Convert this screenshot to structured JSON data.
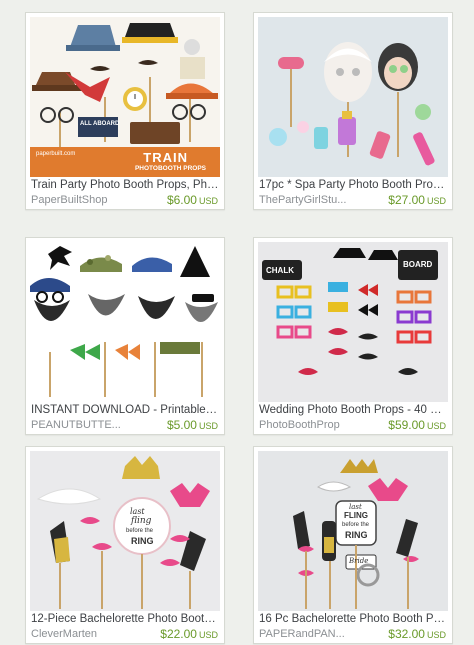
{
  "listings": [
    {
      "title": "Train Party Photo Booth Props, Phot...",
      "shop": "PaperBuiltShop",
      "price": "$6.00",
      "currency": "USD",
      "banner_line1": "TRAIN",
      "banner_line2": "PHOTOBOOTH PROPS",
      "sign_text": "ALL ABOARD",
      "watermark": "paperbuilt.com"
    },
    {
      "title": "17pc * Spa Party Photo Booth Props...",
      "shop": "ThePartyGirlStu...",
      "price": "$27.00",
      "currency": "USD"
    },
    {
      "title": "INSTANT DOWNLOAD - Printable D...",
      "shop": "PEANUTBUTTE...",
      "price": "$5.00",
      "currency": "USD"
    },
    {
      "title": "Wedding Photo Booth Props - 40 Pi...",
      "shop": "PhotoBoothProp",
      "price": "$59.00",
      "currency": "USD",
      "sign1": "CHALK",
      "sign2": "BOARD"
    },
    {
      "title": "12-Piece Bachelorette Photo Booth ...",
      "shop": "CleverMarten",
      "price": "$22.00",
      "currency": "USD",
      "sign_line1": "last",
      "sign_line2": "fling",
      "sign_line3": "before the",
      "sign_line4": "RING"
    },
    {
      "title": "16 Pc Bachelorette Photo Booth Pro...",
      "shop": "PAPERandPAN...",
      "price": "$32.00",
      "currency": "USD",
      "sign_line1": "last",
      "sign_line2": "FLING",
      "sign_line3": "before the",
      "sign_line4": "RING",
      "bride_text": "Bride"
    }
  ]
}
